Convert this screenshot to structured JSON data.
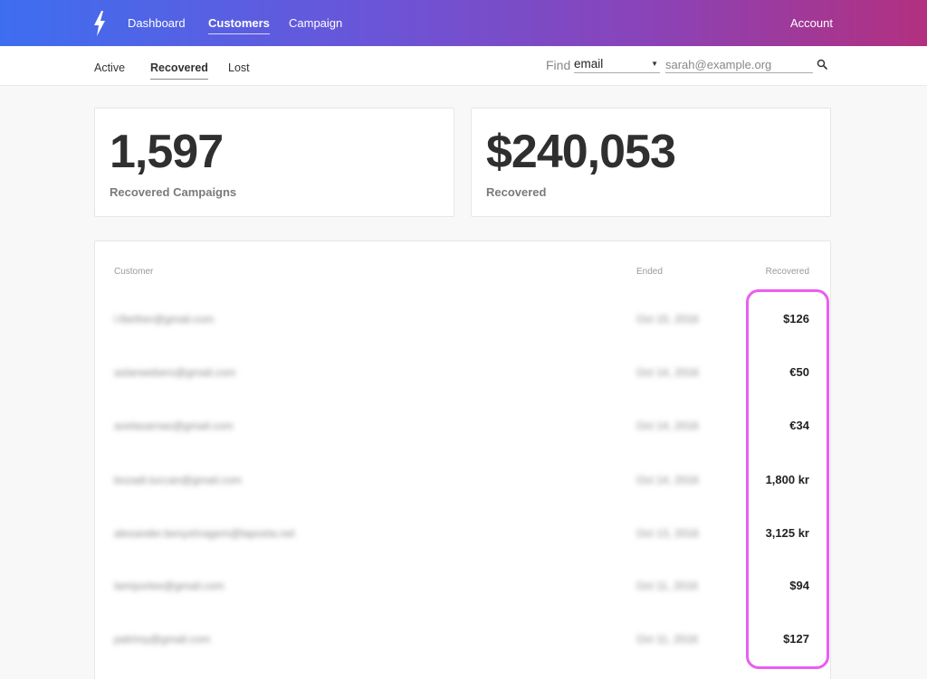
{
  "nav": {
    "logo_icon": "lightning-bolt-icon",
    "items": [
      {
        "label": "Dashboard",
        "active": false
      },
      {
        "label": "Customers",
        "active": true
      },
      {
        "label": "Campaign",
        "active": false
      }
    ],
    "account_label": "Account"
  },
  "subnav": {
    "tabs": [
      {
        "label": "Active",
        "active": false
      },
      {
        "label": "Recovered",
        "active": true
      },
      {
        "label": "Lost",
        "active": false
      }
    ],
    "find_label": "Find",
    "find_field": "email",
    "find_placeholder": "sarah@example.org"
  },
  "stats": [
    {
      "value": "1,597",
      "label": "Recovered Campaigns"
    },
    {
      "value": "$240,053",
      "label": "Recovered"
    }
  ],
  "table": {
    "headers": {
      "customer": "Customer",
      "ended": "Ended",
      "recovered": "Recovered"
    },
    "rows": [
      {
        "customer": "l.lfarther@gmail.com",
        "ended": "Oct 15, 2016",
        "recovered": "$126"
      },
      {
        "customer": "aslanwebers@gmail.com",
        "ended": "Oct 14, 2016",
        "recovered": "€50"
      },
      {
        "customer": "avelasarnas@gmail.com",
        "ended": "Oct 14, 2016",
        "recovered": "€34"
      },
      {
        "customer": "bozadi.tuccan@gmail.com",
        "ended": "Oct 14, 2016",
        "recovered": "1,800 kr"
      },
      {
        "customer": "alexander.benyshragem@lapoeta.net",
        "ended": "Oct 13, 2016",
        "recovered": "3,125 kr"
      },
      {
        "customer": "lamiyorlee@gmail.com",
        "ended": "Oct 11, 2016",
        "recovered": "$94"
      },
      {
        "customer": "patrimy@gmail.com",
        "ended": "Oct 11, 2016",
        "recovered": "$127"
      }
    ]
  },
  "colors": {
    "gradient_start": "#3e6ef0",
    "gradient_end": "#b2307f",
    "highlight": "#e74df0"
  }
}
